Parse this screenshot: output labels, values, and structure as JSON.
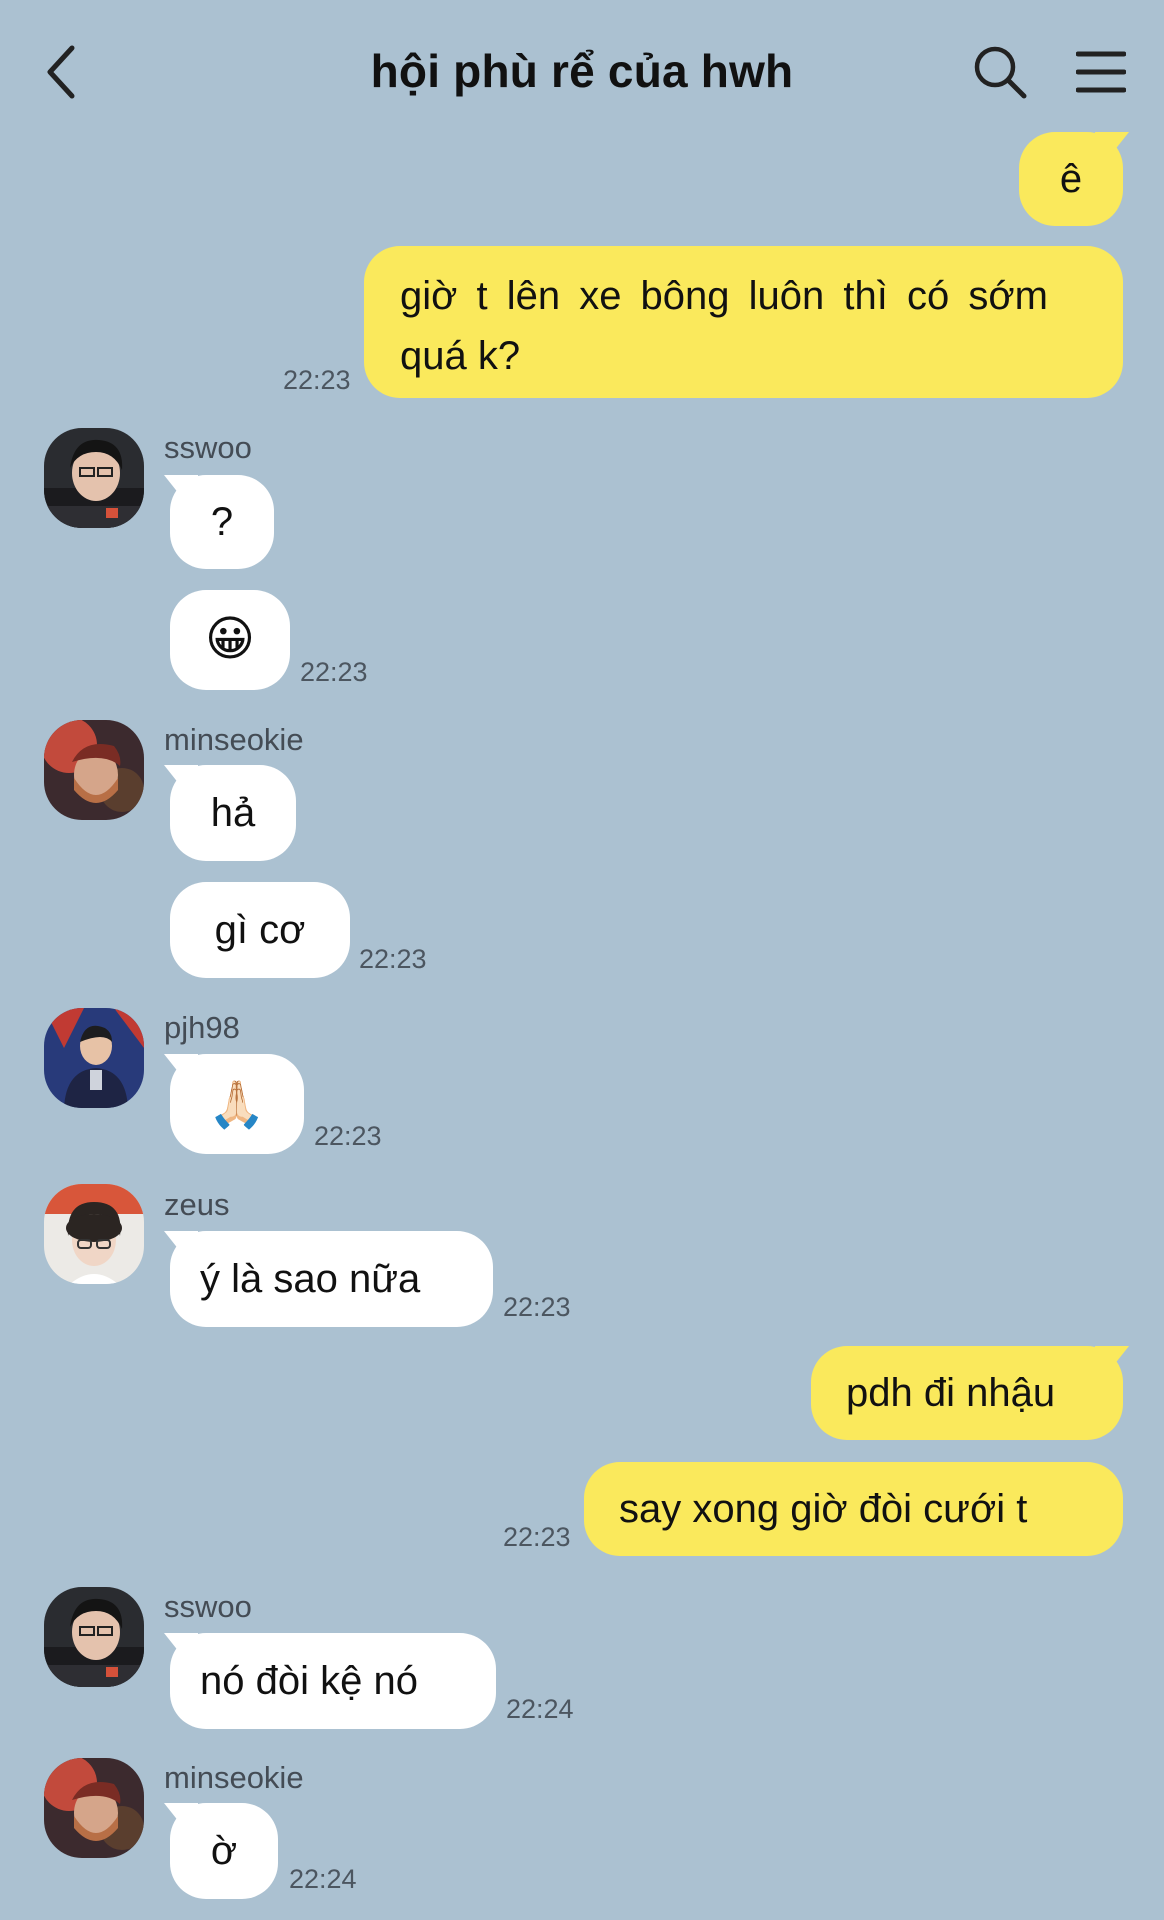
{
  "header": {
    "title": "hội phù rể của hwh",
    "back_icon": "chevron-left-icon",
    "search_icon": "search-icon",
    "menu_icon": "hamburger-menu-icon"
  },
  "colors": {
    "background": "#abc1d1",
    "my_bubble": "#fae95c",
    "other_bubble": "#ffffff"
  },
  "messages": {
    "m1": {
      "text": "ê"
    },
    "m2": {
      "line1": "giờ t lên xe bông luôn thì có sớm",
      "line2": "quá k?",
      "time": "22:23"
    },
    "g1": {
      "sender": "sswoo",
      "m1": "?",
      "m2": "😀",
      "time": "22:23"
    },
    "g2": {
      "sender": "minseokie",
      "m1": "hả",
      "m2": "gì cơ",
      "time": "22:23"
    },
    "g3": {
      "sender": "pjh98",
      "m1": "🙏🏻",
      "time": "22:23"
    },
    "g4": {
      "sender": "zeus",
      "m1": "ý là sao nữa",
      "time": "22:23"
    },
    "m3": {
      "text": "pdh đi nhậu"
    },
    "m4": {
      "text": "say xong giờ đòi cưới t",
      "time": "22:23"
    },
    "g5": {
      "sender": "sswoo",
      "m1": "nó đòi kệ nó",
      "time": "22:24"
    },
    "g6": {
      "sender": "minseokie",
      "m1": "ờ",
      "time": "22:24"
    }
  }
}
